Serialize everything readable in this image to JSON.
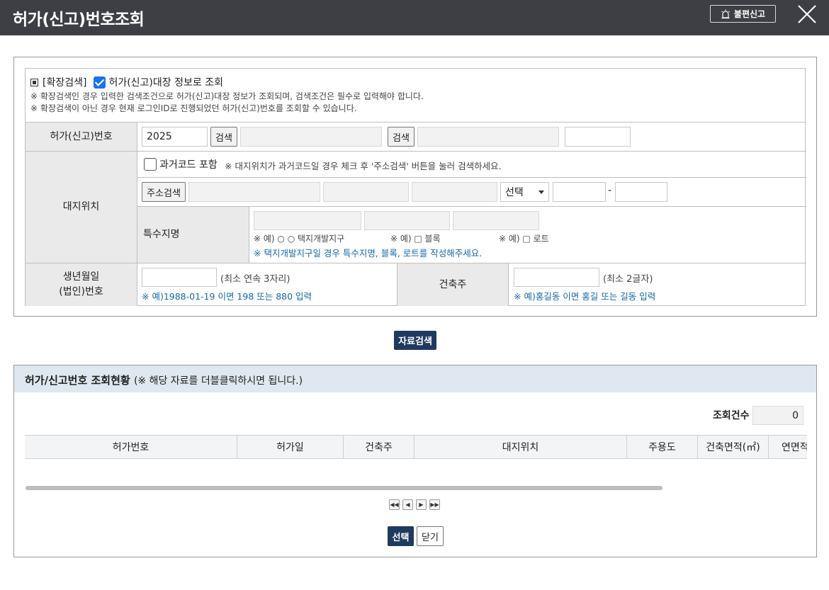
{
  "header": {
    "title": "허가(신고)번호조회",
    "complaint_label": "불편신고"
  },
  "search": {
    "ext_label": "[확장검색]",
    "ext_checkbox_label": "허가(신고)대장 정보로 조회",
    "note1": "※ 확장검색인 경우 입력한 검색조건으로 허가(신고)대장 정보가 조회되며, 검색조건은 필수로 입력해야 합니다.",
    "note2": "※ 확장검색이 아닌 경우 현재 로그인ID로 진행되었던 허가(신고)번호를 조회할 수 있습니다.",
    "permit_no_label": "허가(신고)번호",
    "permit_year": "2025",
    "search_btn": "검색",
    "site_label": "대지위치",
    "past_code_label": "과거코드 포함",
    "past_code_note": "※ 대지위치가 과거코드일 경우 체크 후 '주소검색' 버튼을 눌러 검색하세요.",
    "addr_search_btn": "주소검색",
    "select_value": "선택",
    "dash": "-",
    "special_label": "특수지명",
    "ex1": "※ 예) ○ ○ 택지개발지구",
    "ex2": "※ 예) □ 블록",
    "ex3": "※ 예) □ 로트",
    "special_note": "※ 택지개발지구일 경우 특수지명, 블록, 로트를 작성해주세요.",
    "birth_label_1": "생년월일",
    "birth_label_2": "(법인)번호",
    "birth_hint": "(최소 연속 3자리)",
    "birth_note": "※ 예)1988-01-19 이면 198 또는 880 입력",
    "owner_label": "건축주",
    "owner_hint": "(최소 2글자)",
    "owner_note": "※ 예)홍길동 이면 홍길 또는 길동 입력"
  },
  "data_search_btn": "자료검색",
  "results": {
    "title": "허가/신고번호 조회현황",
    "subtitle": "(※ 해당 자료를 더블클릭하시면 됩니다.)",
    "count_label": "조회건수",
    "count_value": "0",
    "columns": [
      "허가번호",
      "허가일",
      "건축주",
      "대지위치",
      "주용도",
      "건축면적(㎡)",
      "연면적"
    ]
  },
  "footer": {
    "select_btn": "선택",
    "close_btn": "닫기"
  },
  "colors": {
    "header_bg": "#3d3f45",
    "navy": "#1f3a5f",
    "note_blue": "#1769aa",
    "result_header_bg": "#dfe8f1"
  }
}
